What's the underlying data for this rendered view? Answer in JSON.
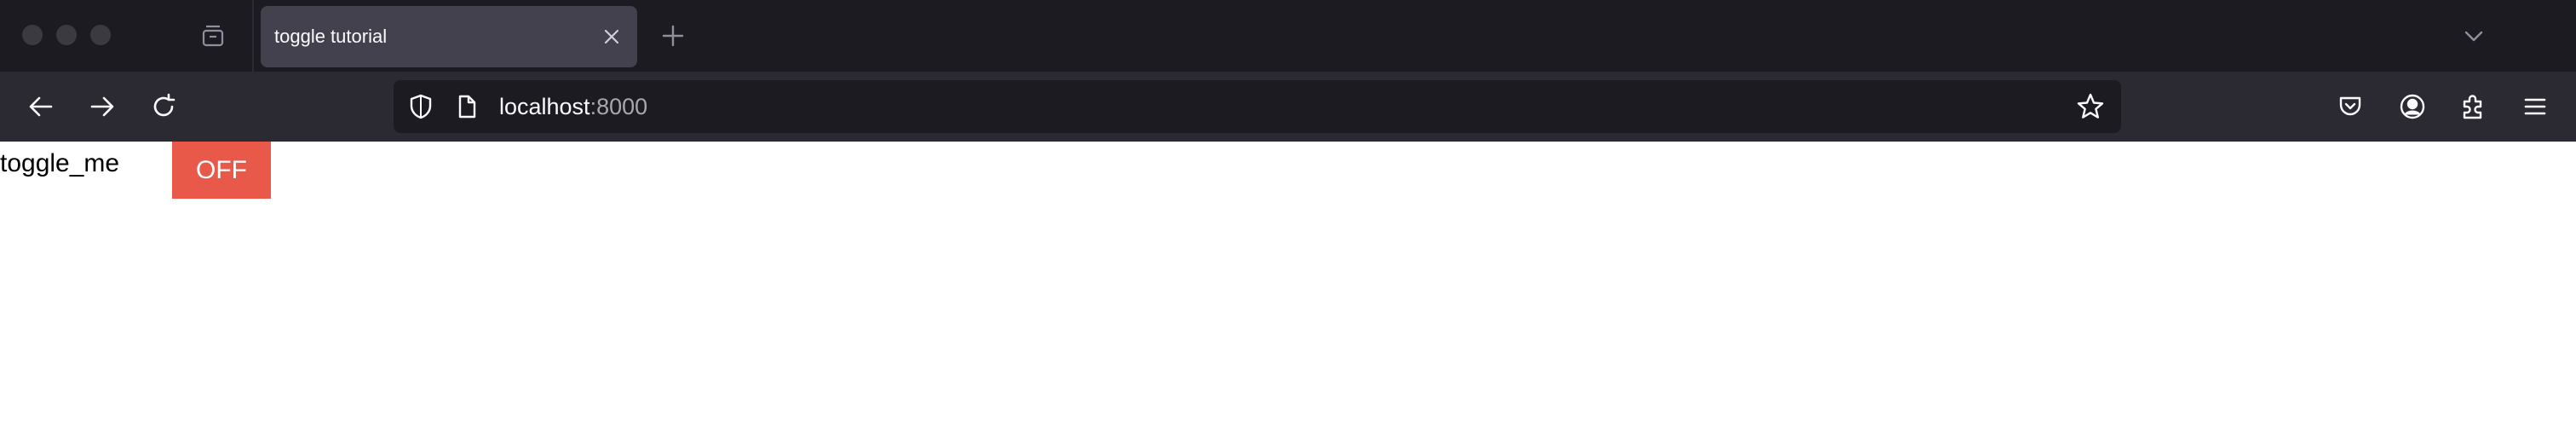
{
  "window": {
    "traffic_lights": [
      "close",
      "minimize",
      "zoom"
    ]
  },
  "tabs": [
    {
      "title": "toggle tutorial",
      "active": true
    }
  ],
  "toolbar": {
    "url_host": "localhost",
    "url_port": ":8000"
  },
  "page": {
    "toggle_label": "toggle_me",
    "toggle_state": "OFF",
    "toggle_color": "#e8594a"
  },
  "icons": {
    "tab_list": "tab-list-icon",
    "tab_close": "close-icon",
    "new_tab": "plus-icon",
    "tab_overflow": "chevron-down-icon",
    "back": "arrow-left-icon",
    "forward": "arrow-right-icon",
    "reload": "reload-icon",
    "tracking_protection": "shield-icon",
    "page_info": "page-icon",
    "bookmark": "star-icon",
    "pocket": "pocket-icon",
    "account": "account-icon",
    "extensions": "puzzle-icon",
    "menu": "hamburger-menu-icon"
  },
  "colors": {
    "tabstrip_bg": "#1c1b22",
    "toolbar_bg": "#2b2a33",
    "active_tab_bg": "#42414d",
    "urlbar_bg": "#1c1b22",
    "icon_color": "#fbfbfe"
  }
}
